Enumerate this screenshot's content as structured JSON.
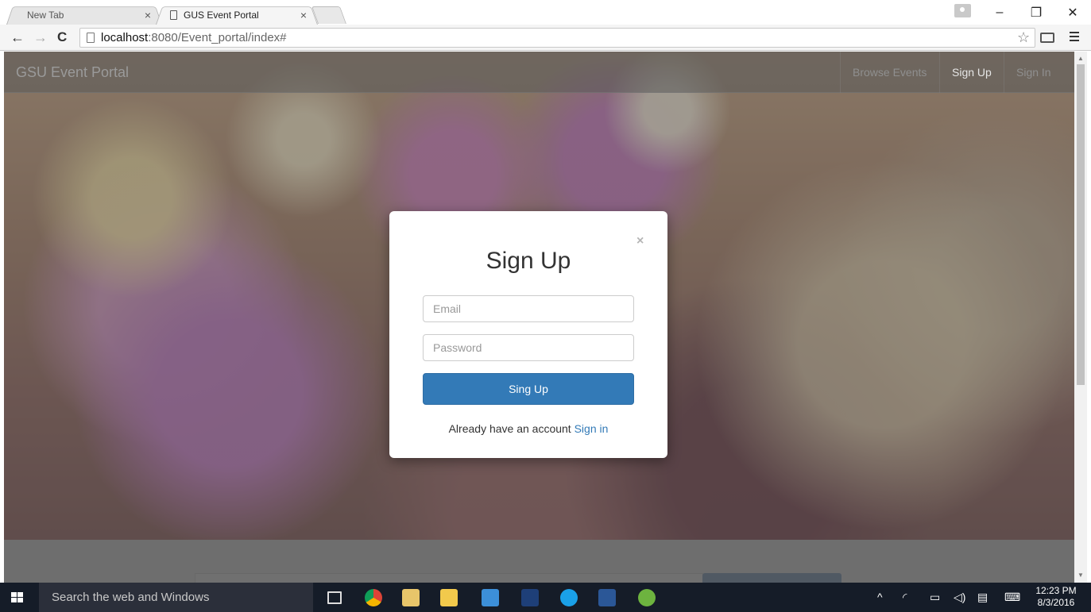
{
  "browser": {
    "tabs": [
      {
        "title": "New Tab",
        "close": "×"
      },
      {
        "title": "GUS Event Portal",
        "close": "×"
      }
    ],
    "window_controls": {
      "minimize": "–",
      "restore": "❐",
      "close": "✕"
    },
    "nav": {
      "back": "←",
      "forward": "→",
      "reload": "C"
    },
    "url_host": "localhost",
    "url_path": ":8080/Event_portal/index#",
    "star": "☆"
  },
  "navbar": {
    "brand": "GSU Event Portal",
    "links": [
      {
        "label": "Browse Events",
        "active": false
      },
      {
        "label": "Sign Up",
        "active": true
      },
      {
        "label": "Sign In",
        "active": false
      }
    ]
  },
  "modal": {
    "close": "×",
    "title": "Sign Up",
    "email_placeholder": "Email",
    "password_placeholder": "Password",
    "submit_label": "Sing Up",
    "account_prompt": "Already have an account",
    "signin_link": "Sign in"
  },
  "taskbar": {
    "search_placeholder": "Search the web and Windows",
    "tray_chevron": "^",
    "time": "12:23 PM",
    "date": "8/3/2016"
  },
  "colors": {
    "primary": "#337ab7",
    "taskbar": "#151c28"
  }
}
